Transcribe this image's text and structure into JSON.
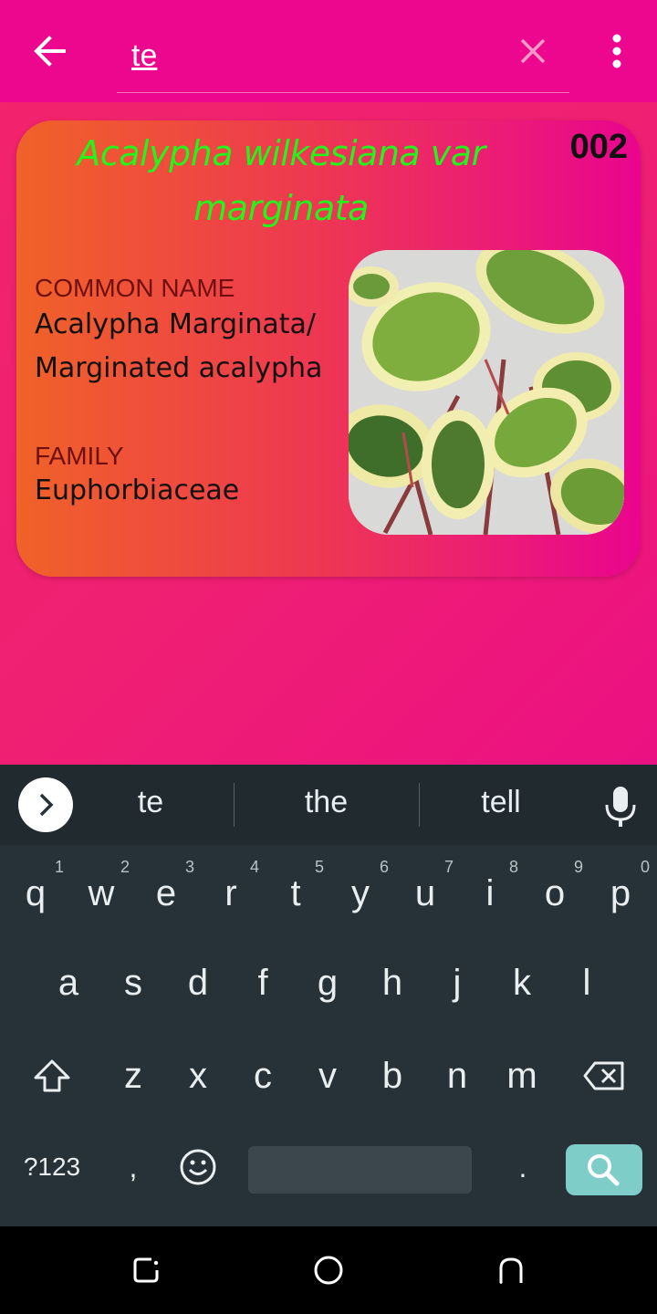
{
  "header": {
    "back_icon": "arrow-left-icon",
    "search_value": "te",
    "clear_icon": "close-icon",
    "more_icon": "more-vert-icon"
  },
  "card": {
    "scientific_name": "Acalypha wilkesiana var marginata",
    "number": "002",
    "common_name_label": "COMMON NAME",
    "common_name_line1": "Acalypha Marginata/",
    "common_name_line2": "Marginated acalypha",
    "family_label": "FAMILY",
    "family_value": "Euphorbiaceae",
    "photo_icon": "plant-photo",
    "title_color": "#22f51a"
  },
  "keyboard": {
    "suggestions": [
      "te",
      "the",
      "tell"
    ],
    "row1": [
      {
        "key": "q",
        "hint": "1"
      },
      {
        "key": "w",
        "hint": "2"
      },
      {
        "key": "e",
        "hint": "3"
      },
      {
        "key": "r",
        "hint": "4"
      },
      {
        "key": "t",
        "hint": "5"
      },
      {
        "key": "y",
        "hint": "6"
      },
      {
        "key": "u",
        "hint": "7"
      },
      {
        "key": "i",
        "hint": "8"
      },
      {
        "key": "o",
        "hint": "9"
      },
      {
        "key": "p",
        "hint": "0"
      }
    ],
    "row2": [
      "a",
      "s",
      "d",
      "f",
      "g",
      "h",
      "j",
      "k",
      "l"
    ],
    "row3": [
      "z",
      "x",
      "c",
      "v",
      "b",
      "n",
      "m"
    ],
    "symbols_label": "?123",
    "comma_label": ",",
    "period_label": ".",
    "search_key_color": "#7fcdc8"
  },
  "navbar": {
    "recents_icon": "recents-icon",
    "home_icon": "home-icon",
    "back_icon": "back-icon"
  }
}
